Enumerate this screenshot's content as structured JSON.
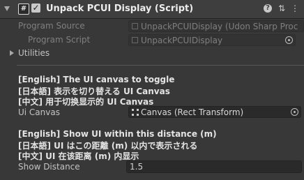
{
  "header": {
    "title": "Unpack PCUI Display (Script)",
    "script_icon": "#",
    "enabled_check": "✓",
    "enabled": true,
    "icons": [
      "help-icon",
      "presets-icon",
      "context-menu-icon"
    ]
  },
  "fields": {
    "program_source_label": "Program Source",
    "program_source_value": "UnpackPCUIDisplay (Udon Sharp Proc",
    "program_script_label": "Program Script",
    "program_script_value": "UnpackPCUIDisplay",
    "utilities_label": "Utilities"
  },
  "canvas_section": {
    "desc_en": "[English] The UI canvas to toggle",
    "desc_ja": "[日本語] 表示を切り替える UI Canvas",
    "desc_zh": "[中文] 用于切换显示的 UI Canvas",
    "label": "Ui Canvas",
    "value": "Canvas (Rect Transform)"
  },
  "distance_section": {
    "desc_en": "[English] Show UI within this distance (m)",
    "desc_ja": "[日本語] UI はこの距離 (m) 以内で表示される",
    "desc_zh": "[中文] UI 在该距离 (m) 内显示",
    "label": "Show Distance",
    "value": "1.5"
  }
}
